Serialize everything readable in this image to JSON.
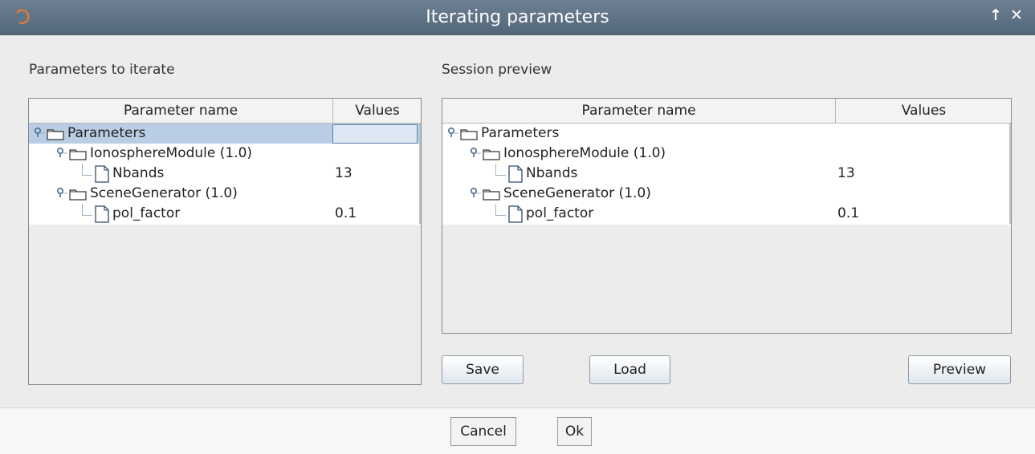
{
  "window": {
    "title": "Iterating parameters",
    "pin_glyph": "↑",
    "close_glyph": "✕"
  },
  "left": {
    "label": "Parameters to iterate",
    "columns": [
      "Parameter name",
      "Values"
    ],
    "rows": [
      {
        "label": "Parameters",
        "value": "",
        "kind": "folder",
        "level": 0,
        "selected": true
      },
      {
        "label": "IonosphereModule (1.0)",
        "value": "",
        "kind": "folder",
        "level": 1
      },
      {
        "label": "Nbands",
        "value": "13",
        "kind": "file",
        "level": 2
      },
      {
        "label": "SceneGenerator (1.0)",
        "value": "",
        "kind": "folder",
        "level": 1
      },
      {
        "label": "pol_factor",
        "value": "0.1",
        "kind": "file",
        "level": 2
      }
    ]
  },
  "right": {
    "label": "Session preview",
    "columns": [
      "Parameter name",
      "Values"
    ],
    "rows": [
      {
        "label": "Parameters",
        "value": "",
        "kind": "folder",
        "level": 0
      },
      {
        "label": "IonosphereModule (1.0)",
        "value": "",
        "kind": "folder",
        "level": 1
      },
      {
        "label": "Nbands",
        "value": "13",
        "kind": "file",
        "level": 2
      },
      {
        "label": "SceneGenerator (1.0)",
        "value": "",
        "kind": "folder",
        "level": 1
      },
      {
        "label": "pol_factor",
        "value": "0.1",
        "kind": "file",
        "level": 2
      }
    ],
    "buttons": {
      "save": "Save",
      "load": "Load",
      "preview": "Preview"
    }
  },
  "footer": {
    "cancel": "Cancel",
    "ok": "Ok"
  },
  "icons": {
    "folder": "folder-icon",
    "file": "file-icon",
    "expander": "tree-expander-icon"
  }
}
